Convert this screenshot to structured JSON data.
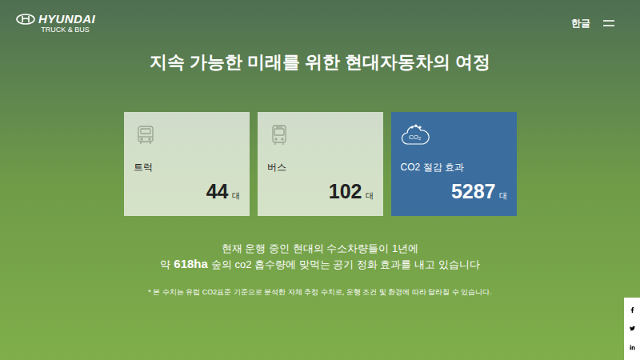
{
  "header": {
    "logo": {
      "brand": "HYUNDAI",
      "sub": "TRUCK & BUS"
    },
    "language": "한글"
  },
  "title": "지속 가능한 미래를 위한 현대자동차의 여정",
  "stats": [
    {
      "kind": "truck",
      "label": "트럭",
      "value": "44",
      "unit": "대",
      "highlighted": false
    },
    {
      "kind": "bus",
      "label": "버스",
      "value": "102",
      "unit": "대",
      "highlighted": false
    },
    {
      "kind": "co2",
      "label": "CO2 절감 효과",
      "value": "5287",
      "unit": "대",
      "highlighted": true,
      "icon_text": "CO₂"
    }
  ],
  "summary": {
    "line1": "현재 운행 중인 현대의 수소차량들이 1년에",
    "line2_prefix": "약",
    "line2_highlight": "618ha",
    "line2_suffix": "숲의 co2 흡수량에 맞먹는 공기 정화 효과를 내고 있습니다"
  },
  "footnote": "* 본 수치는 유럽 CO2표준 기준으로 분석한 자체 추정 수치로, 운행 조건 및 환경에 따라 달라질 수 있습니다."
}
